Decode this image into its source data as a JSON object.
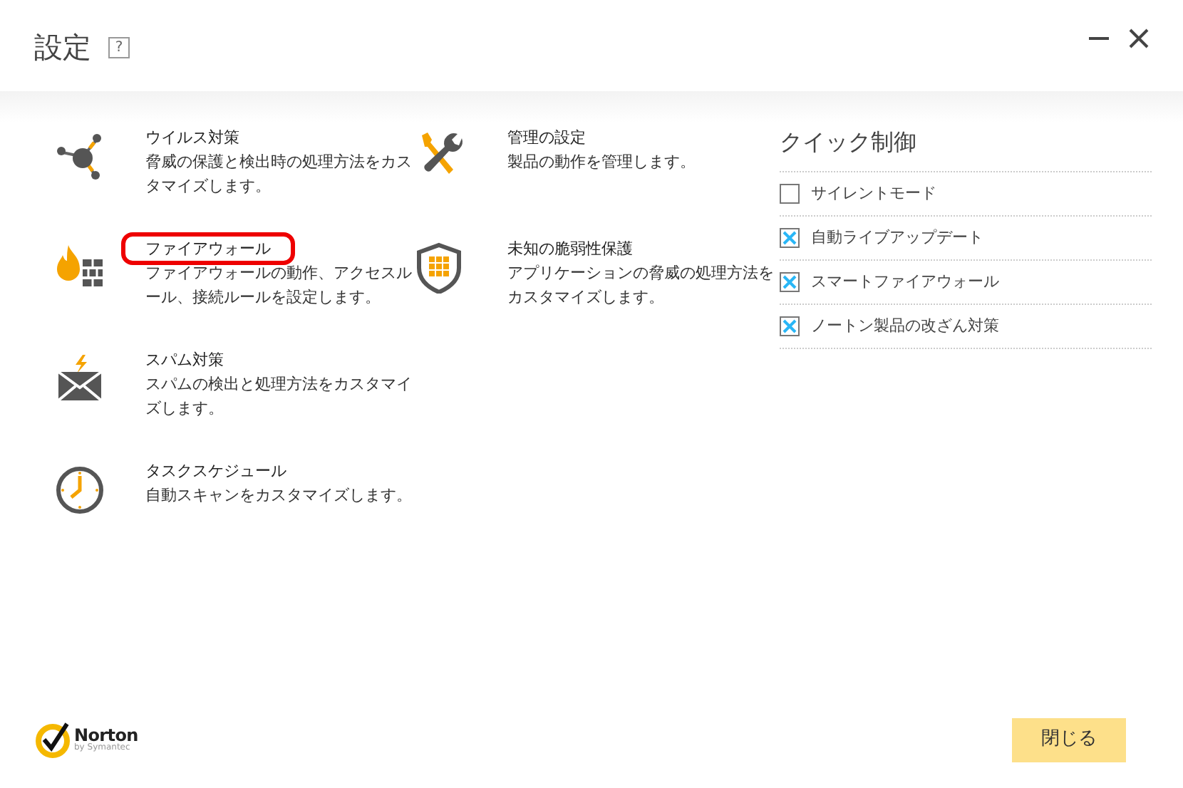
{
  "window": {
    "title": "設定",
    "help": "?"
  },
  "columns": [
    [
      {
        "kind": "virus",
        "title": "ウイルス対策",
        "description": "脅威の保護と検出時の処理方法をカスタマイズします。",
        "highlighted": false
      },
      {
        "kind": "firewall",
        "title": "ファイアウォール",
        "description": "ファイアウォールの動作、アクセスルール、接続ルールを設定します。",
        "highlighted": true
      },
      {
        "kind": "spam",
        "title": "スパム対策",
        "description": "スパムの検出と処理方法をカスタマイズします。",
        "highlighted": false
      },
      {
        "kind": "schedule",
        "title": "タスクスケジュール",
        "description": "自動スキャンをカスタマイズします。",
        "highlighted": false
      }
    ],
    [
      {
        "kind": "admin",
        "title": "管理の設定",
        "description": "製品の動作を管理します。",
        "highlighted": false
      },
      {
        "kind": "vulnerability",
        "title": "未知の脆弱性保護",
        "description": "アプリケーションの脅威の処理方法をカスタマイズします。",
        "highlighted": false
      }
    ]
  ],
  "quick_controls": {
    "title": "クイック制御",
    "items": [
      {
        "label": "サイレントモード",
        "checked": false
      },
      {
        "label": "自動ライブアップデート",
        "checked": true
      },
      {
        "label": "スマートファイアウォール",
        "checked": true
      },
      {
        "label": "ノートン製品の改ざん対策",
        "checked": true
      }
    ]
  },
  "logo": {
    "name": "Norton",
    "tagline": "by Symantec"
  },
  "buttons": [
    "閉じる"
  ]
}
